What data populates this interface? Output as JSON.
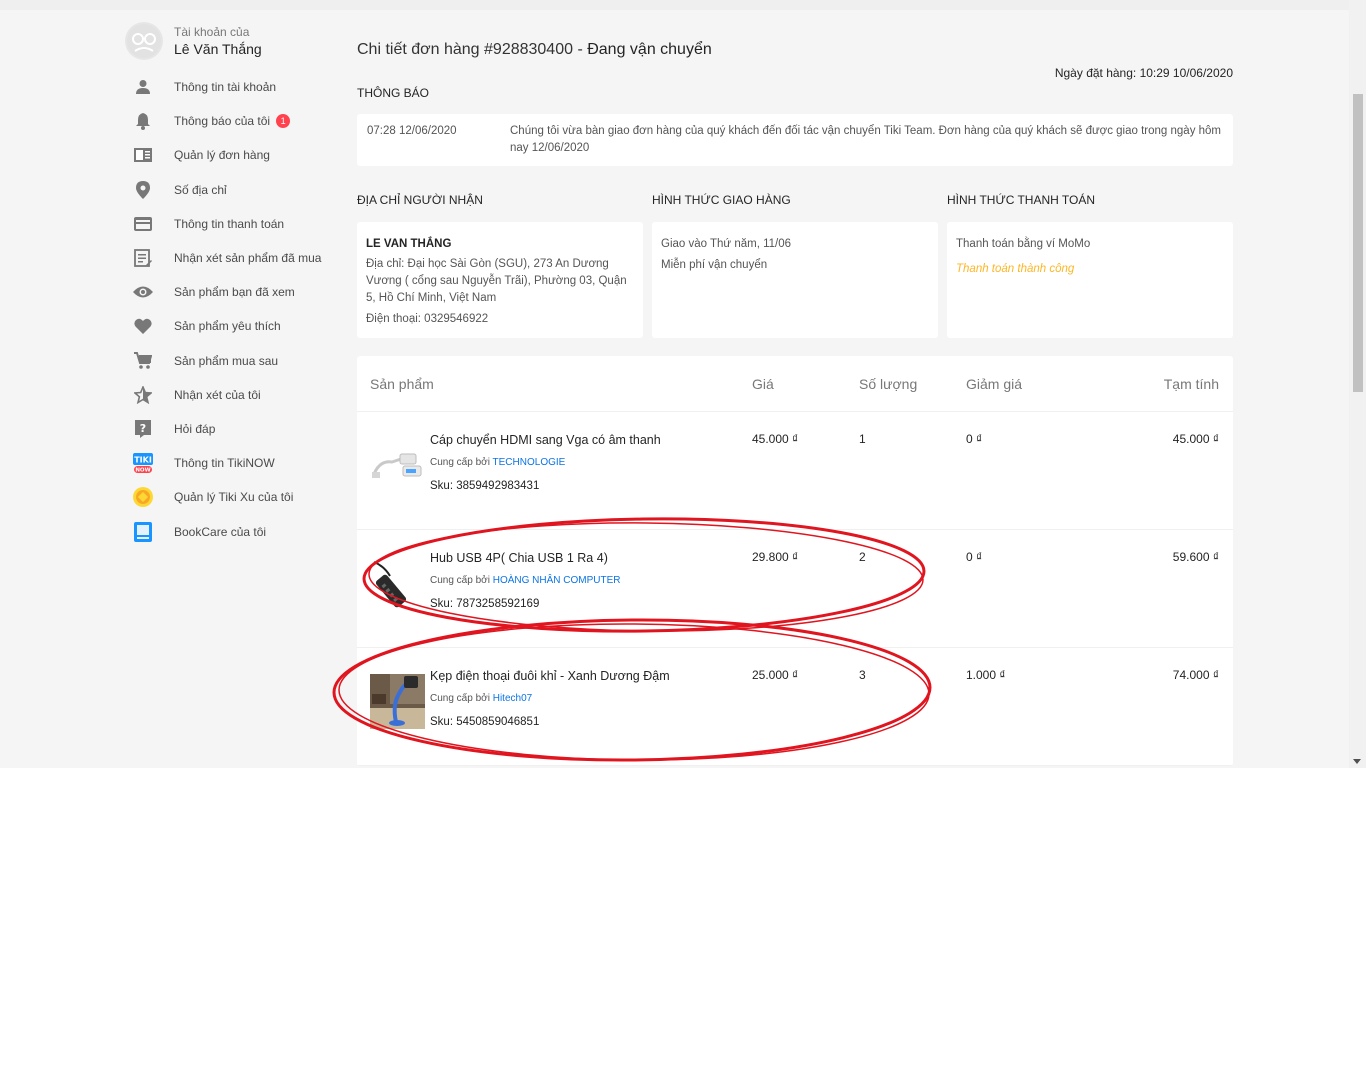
{
  "account": {
    "label": "Tài khoản của",
    "name": "Lê Văn Thắng"
  },
  "sidebar": {
    "items": [
      {
        "label": "Thông tin tài khoản",
        "icon": "user-icon"
      },
      {
        "label": "Thông báo của tôi",
        "icon": "bell-icon",
        "badge": "1"
      },
      {
        "label": "Quản lý đơn hàng",
        "icon": "order-list-icon"
      },
      {
        "label": "Số địa chỉ",
        "icon": "location-pin-icon"
      },
      {
        "label": "Thông tin thanh toán",
        "icon": "credit-card-icon"
      },
      {
        "label": "Nhận xét sản phẩm đã mua",
        "icon": "review-edit-icon"
      },
      {
        "label": "Sản phẩm bạn đã xem",
        "icon": "eye-icon"
      },
      {
        "label": "Sản phẩm yêu thích",
        "icon": "heart-icon"
      },
      {
        "label": "Sản phẩm mua sau",
        "icon": "cart-icon"
      },
      {
        "label": "Nhận xét của tôi",
        "icon": "star-icon"
      },
      {
        "label": "Hỏi đáp",
        "icon": "question-icon"
      },
      {
        "label": "Thông tin TikiNOW",
        "icon": "tikinow-icon"
      },
      {
        "label": "Quản lý Tiki Xu của tôi",
        "icon": "tiki-xu-coin-icon"
      },
      {
        "label": "BookCare của tôi",
        "icon": "bookcare-icon"
      }
    ]
  },
  "order": {
    "title_prefix": "Chi tiết đơn hàng #928830400 - ",
    "status": "Đang vận chuyển",
    "date": "Ngày đặt hàng: 10:29 10/06/2020"
  },
  "notice": {
    "heading": "THÔNG BÁO",
    "time": "07:28 12/06/2020",
    "text": "Chúng tôi vừa bàn giao đơn hàng của quý khách đến đối tác vận chuyển Tiki Team. Đơn hàng của quý khách sẽ được giao trong ngày hôm nay 12/06/2020"
  },
  "address": {
    "heading": "ĐỊA CHỈ NGƯỜI NHẬN",
    "name": "LE VAN THẮNG",
    "address": "Địa chỉ: Đại học Sài Gòn (SGU), 273 An Dương Vương ( cổng sau Nguyễn Trãi), Phường 03, Quận 5, Hồ Chí Minh, Việt Nam",
    "phone": "Điện thoại: 0329546922"
  },
  "shipping": {
    "heading": "HÌNH THỨC GIAO HÀNG",
    "line1": "Giao vào Thứ năm, 11/06",
    "line2": "Miễn phí vận chuyển"
  },
  "payment": {
    "heading": "HÌNH THỨC THANH TOÁN",
    "method": "Thanh toán bằng ví MoMo",
    "status": "Thanh toán thành công",
    "status_color": "#fdb626"
  },
  "table": {
    "headers": {
      "product": "Sản phẩm",
      "price": "Giá",
      "qty": "Số lượng",
      "discount": "Giảm giá",
      "subtotal": "Tạm tính"
    },
    "seller_prefix": "Cung cấp bởi ",
    "rows": [
      {
        "name": "Cáp chuyển HDMI sang Vga có âm thanh",
        "seller": "TECHNOLOGIE",
        "sku": "Sku: 3859492983431",
        "price": "45.000 ₫",
        "qty": "1",
        "discount": "0 ₫",
        "subtotal": "45.000 ₫"
      },
      {
        "name": "Hub USB 4P( Chia USB 1 Ra 4)",
        "seller": "HOÀNG NHÂN COMPUTER",
        "sku": "Sku: 7873258592169",
        "price": "29.800 ₫",
        "qty": "2",
        "discount": "0 ₫",
        "subtotal": "59.600 ₫"
      },
      {
        "name": "Kẹp điện thoại đuôi khỉ - Xanh Dương Đậm",
        "seller": "Hitech07",
        "sku": "Sku: 5450859046851",
        "price": "25.000 ₫",
        "qty": "3",
        "discount": "1.000 ₫",
        "subtotal": "74.000 ₫"
      }
    ]
  },
  "colors": {
    "badge": "#ff424e",
    "link": "#0b74e5",
    "annotation": "#e0151f"
  }
}
